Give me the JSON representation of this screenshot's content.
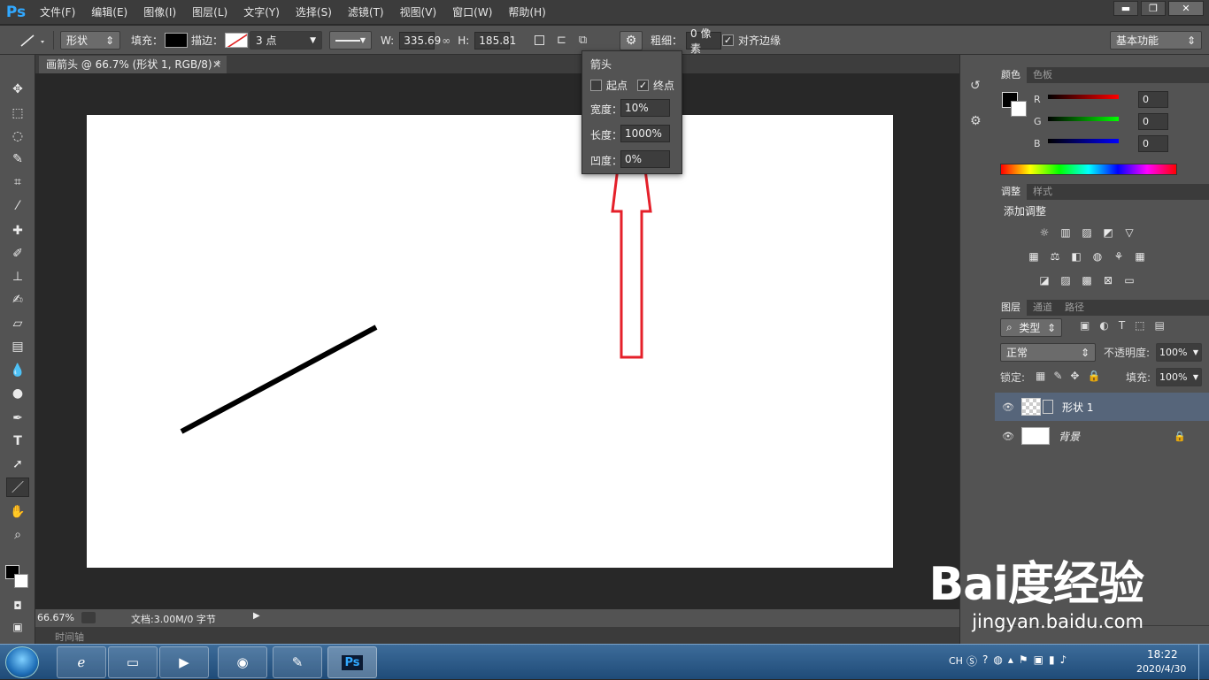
{
  "app": {
    "logo": "Ps",
    "menu": [
      "文件(F)",
      "编辑(E)",
      "图像(I)",
      "图层(L)",
      "文字(Y)",
      "选择(S)",
      "滤镜(T)",
      "视图(V)",
      "窗口(W)",
      "帮助(H)"
    ]
  },
  "window": {
    "min": "▬",
    "restore": "❐",
    "close": "✕"
  },
  "options": {
    "mode": "形状",
    "fill_label": "填充：",
    "stroke_label": "描边：",
    "stroke_size": "3 点",
    "w_label": "W:",
    "w_value": "335.69",
    "h_label": "H:",
    "h_value": "185.81",
    "weight_label": "粗细：",
    "weight_value": "0 像素",
    "align_label": "对齐边缘",
    "workspace": "基本功能"
  },
  "arrow_popup": {
    "title": "箭头",
    "start_label": "起点",
    "end_label": "终点",
    "width_label": "宽度：",
    "width_value": "10%",
    "length_label": "长度：",
    "length_value": "1000%",
    "concavity_label": "凹度：",
    "concavity_value": "0%",
    "start_checked": false,
    "end_checked": true
  },
  "document": {
    "tab": "画箭头 @ 66.7% (形状 1, RGB/8) *",
    "zoom": "66.67%",
    "doc_info": "文档:3.00M/0 字节",
    "timeline": "时间轴"
  },
  "color_panel": {
    "tab_color": "颜色",
    "tab_swatches": "色板",
    "r_label": "R",
    "g_label": "G",
    "b_label": "B",
    "r": "0",
    "g": "0",
    "b": "0"
  },
  "adjust_panel": {
    "tab_adjust": "调整",
    "tab_styles": "样式",
    "title": "添加调整"
  },
  "layers_panel": {
    "tab_layers": "图层",
    "tab_channels": "通道",
    "tab_paths": "路径",
    "filter": "类型",
    "blend": "正常",
    "opacity_label": "不透明度:",
    "opacity": "100%",
    "lock_label": "锁定:",
    "fill_label": "填充:",
    "fill": "100%",
    "layers": [
      {
        "name": "形状 1"
      },
      {
        "name": "背景"
      }
    ]
  },
  "taskbar": {
    "lang": "CH",
    "time": "18:22",
    "date": "2020/4/30"
  },
  "watermark": {
    "logo": "Bai度经验",
    "url": "jingyan.baidu.com"
  },
  "colors": {
    "accent": "#31a8ff",
    "annotation": "#e5202a"
  }
}
